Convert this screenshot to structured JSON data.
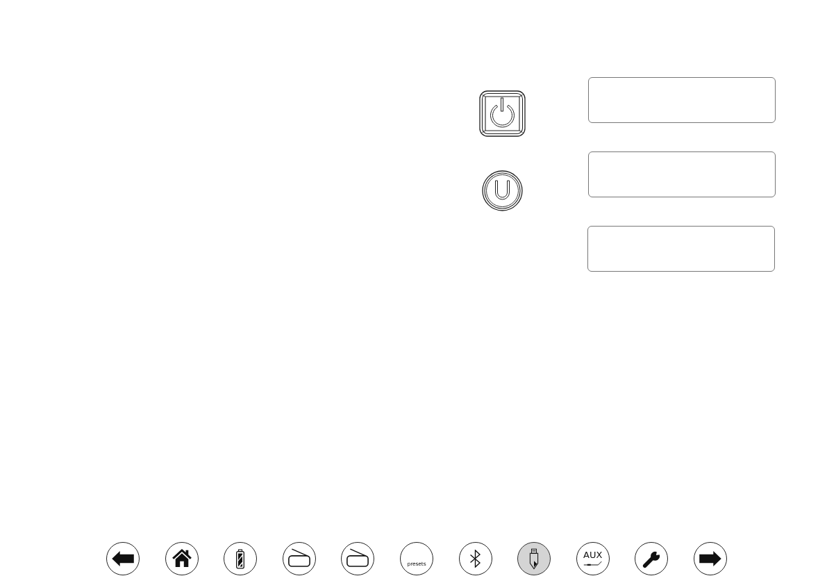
{
  "device_buttons": [
    {
      "kind": "power"
    },
    {
      "kind": "standby"
    }
  ],
  "nav_buttons": [
    {
      "kind": "back",
      "selected": false
    },
    {
      "kind": "home",
      "selected": false
    },
    {
      "kind": "battery",
      "selected": false
    },
    {
      "kind": "radio",
      "selected": false
    },
    {
      "kind": "radio",
      "selected": false
    },
    {
      "kind": "presets",
      "label": "presets",
      "selected": false
    },
    {
      "kind": "bluetooth",
      "selected": false
    },
    {
      "kind": "usb",
      "selected": true
    },
    {
      "kind": "aux",
      "label": "AUX",
      "selected": false
    },
    {
      "kind": "settings",
      "selected": false
    },
    {
      "kind": "forward",
      "selected": false
    }
  ]
}
